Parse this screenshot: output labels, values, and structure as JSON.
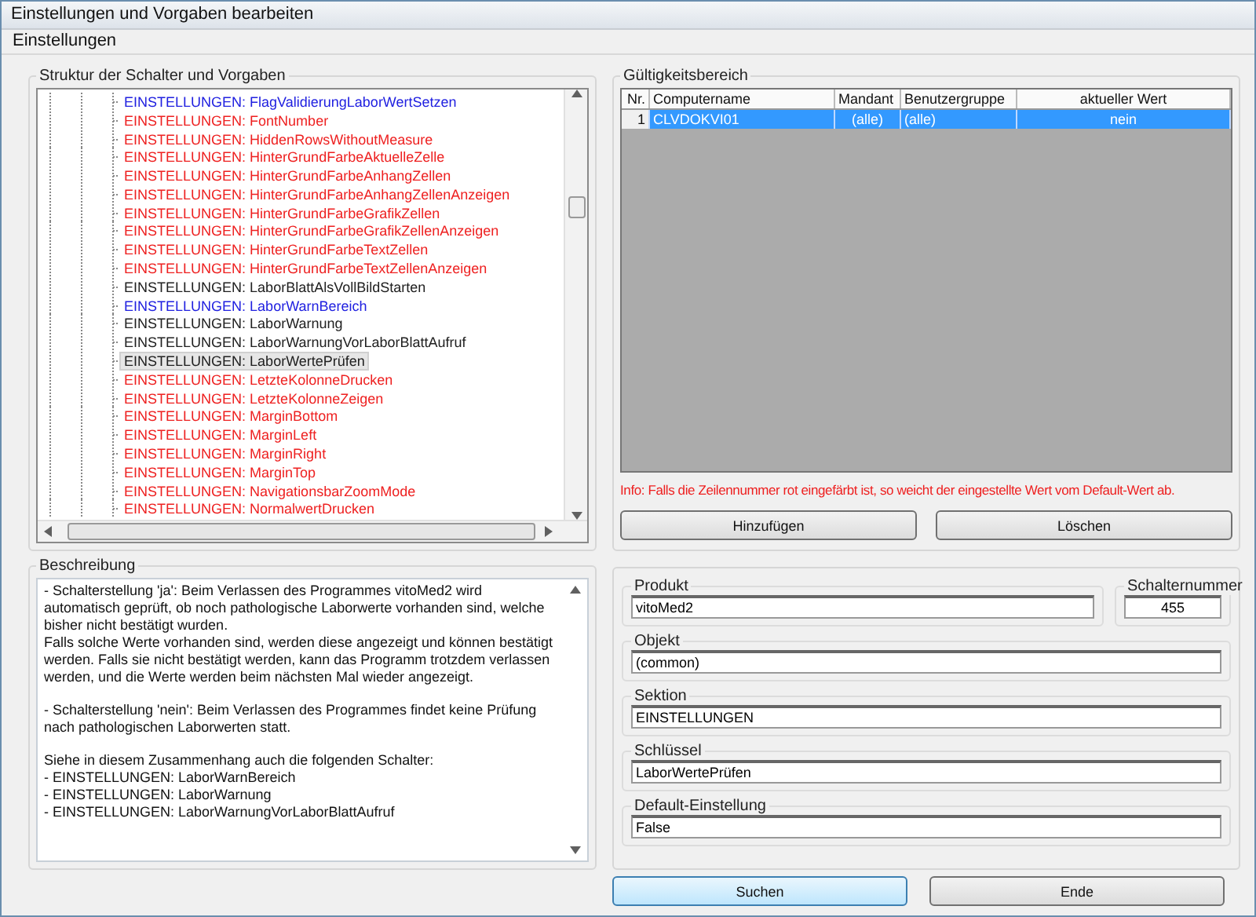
{
  "window": {
    "title": "Einstellungen und Vorgaben bearbeiten"
  },
  "menu": [
    "Einstellungen"
  ],
  "tree": {
    "title": "Struktur der Schalter und Vorgaben",
    "items": [
      {
        "section": "EINSTELLUNGEN:",
        "name": "FlagValidierungLaborWertSetzen",
        "color": "#2020e0",
        "selected": false
      },
      {
        "section": "EINSTELLUNGEN:",
        "name": "FontNumber",
        "color": "#ee2020",
        "selected": false
      },
      {
        "section": "EINSTELLUNGEN:",
        "name": "HiddenRowsWithoutMeasure",
        "color": "#ee2020",
        "selected": false
      },
      {
        "section": "EINSTELLUNGEN:",
        "name": "HinterGrundFarbeAktuelleZelle",
        "color": "#ee2020",
        "selected": false
      },
      {
        "section": "EINSTELLUNGEN:",
        "name": "HinterGrundFarbeAnhangZellen",
        "color": "#ee2020",
        "selected": false
      },
      {
        "section": "EINSTELLUNGEN:",
        "name": "HinterGrundFarbeAnhangZellenAnzeigen",
        "color": "#ee2020",
        "selected": false
      },
      {
        "section": "EINSTELLUNGEN:",
        "name": "HinterGrundFarbeGrafikZellen",
        "color": "#ee2020",
        "selected": false
      },
      {
        "section": "EINSTELLUNGEN:",
        "name": "HinterGrundFarbeGrafikZellenAnzeigen",
        "color": "#ee2020",
        "selected": false
      },
      {
        "section": "EINSTELLUNGEN:",
        "name": "HinterGrundFarbeTextZellen",
        "color": "#ee2020",
        "selected": false
      },
      {
        "section": "EINSTELLUNGEN:",
        "name": "HinterGrundFarbeTextZellenAnzeigen",
        "color": "#ee2020",
        "selected": false
      },
      {
        "section": "EINSTELLUNGEN:",
        "name": "LaborBlattAlsVollBildStarten",
        "color": "#202020",
        "selected": false
      },
      {
        "section": "EINSTELLUNGEN:",
        "name": "LaborWarnBereich",
        "color": "#2020e0",
        "selected": false
      },
      {
        "section": "EINSTELLUNGEN:",
        "name": "LaborWarnung",
        "color": "#202020",
        "selected": false
      },
      {
        "section": "EINSTELLUNGEN:",
        "name": "LaborWarnungVorLaborBlattAufruf",
        "color": "#202020",
        "selected": false
      },
      {
        "section": "EINSTELLUNGEN:",
        "name": "LaborWertePrüfen",
        "color": "#202020",
        "selected": true
      },
      {
        "section": "EINSTELLUNGEN:",
        "name": "LetzteKolonneDrucken",
        "color": "#ee2020",
        "selected": false
      },
      {
        "section": "EINSTELLUNGEN:",
        "name": "LetzteKolonneZeigen",
        "color": "#ee2020",
        "selected": false
      },
      {
        "section": "EINSTELLUNGEN:",
        "name": "MarginBottom",
        "color": "#ee2020",
        "selected": false
      },
      {
        "section": "EINSTELLUNGEN:",
        "name": "MarginLeft",
        "color": "#ee2020",
        "selected": false
      },
      {
        "section": "EINSTELLUNGEN:",
        "name": "MarginRight",
        "color": "#ee2020",
        "selected": false
      },
      {
        "section": "EINSTELLUNGEN:",
        "name": "MarginTop",
        "color": "#ee2020",
        "selected": false
      },
      {
        "section": "EINSTELLUNGEN:",
        "name": "NavigationsbarZoomMode",
        "color": "#ee2020",
        "selected": false
      },
      {
        "section": "EINSTELLUNGEN:",
        "name": "NormalwertDrucken",
        "color": "#ee2020",
        "selected": false
      }
    ]
  },
  "scope": {
    "title": "Gültigkeitsbereich",
    "columns": [
      "Nr.",
      "Computername",
      "Mandant",
      "Benutzergruppe",
      "aktueller Wert"
    ],
    "rows": [
      {
        "cells": [
          "1",
          "CLVDOKVI01",
          "(alle)",
          "(alle)",
          "nein"
        ],
        "selected": true
      }
    ],
    "info": "Info: Falls die Zeilennummer rot eingefärbt ist, so weicht der eingestellte Wert vom Default-Wert ab.",
    "buttons": [
      "Hinzufügen",
      "Löschen"
    ]
  },
  "description": {
    "title": "Beschreibung",
    "paragraphs": [
      "- Schalterstellung 'ja': Beim Verlassen des Programmes vitoMed2 wird automatisch geprüft, ob noch pathologische Laborwerte vorhanden sind, welche bisher nicht bestätigt wurden.\nFalls solche Werte vorhanden sind, werden diese angezeigt und können bestätigt werden. Falls sie nicht bestätigt werden, kann das Programm trotzdem verlassen werden, und die Werte werden beim nächsten Mal wieder angezeigt.",
      "- Schalterstellung 'nein': Beim Verlassen des Programmes findet keine Prüfung nach pathologischen Laborwerten statt.",
      "Siehe in diesem Zusammenhang auch die folgenden Schalter:\n- EINSTELLUNGEN: LaborWarnBereich\n- EINSTELLUNGEN: LaborWarnung\n- EINSTELLUNGEN: LaborWarnungVorLaborBlattAufruf"
    ]
  },
  "details": {
    "product": {
      "label": "Produkt",
      "value": "vitoMed2"
    },
    "number": {
      "label": "Schalternummer",
      "value": "455"
    },
    "fields": [
      {
        "label": "Objekt",
        "value": "(common)"
      },
      {
        "label": "Sektion",
        "value": "EINSTELLUNGEN"
      },
      {
        "label": "Schlüssel",
        "value": "LaborWertePrüfen"
      },
      {
        "label": "Default-Einstellung",
        "value": "False"
      }
    ]
  },
  "buttons": [
    {
      "label": "Suchen",
      "default": true
    },
    {
      "label": "Ende",
      "default": false
    }
  ]
}
